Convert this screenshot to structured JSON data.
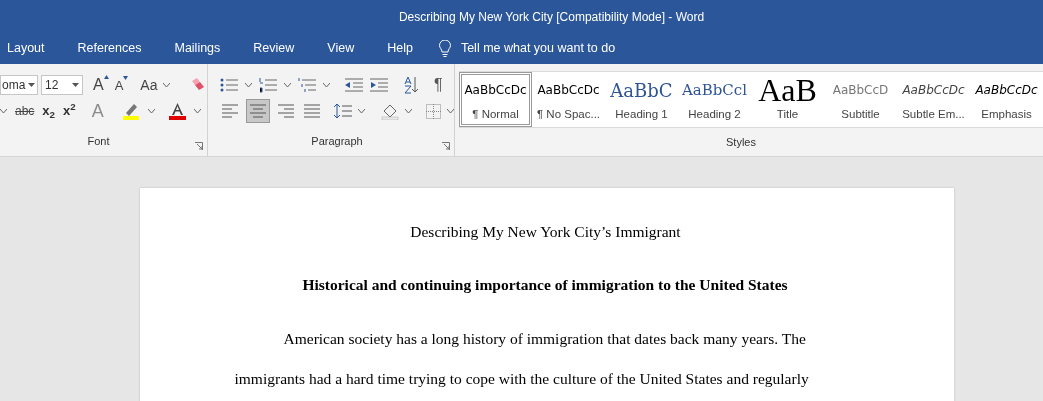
{
  "window": {
    "title": "Describing My New York City [Compatibility Mode]  -  Word"
  },
  "tabs": [
    {
      "label": "Layout",
      "selected": false
    },
    {
      "label": "References",
      "selected": false
    },
    {
      "label": "Mailings",
      "selected": false
    },
    {
      "label": "Review",
      "selected": false
    },
    {
      "label": "View",
      "selected": false
    },
    {
      "label": "Help",
      "selected": false
    }
  ],
  "tell_me": {
    "placeholder": "Tell me what you want to do"
  },
  "font_group": {
    "font_name": "oma",
    "font_size": "12",
    "grow_font": "A",
    "shrink_font": "A",
    "change_case": "Aa",
    "strikethrough": "abc",
    "subscript": "x$_{2}$",
    "superscript": "x$^{2}$",
    "text_effects": "A",
    "label": "Font"
  },
  "paragraph_group": {
    "label": "Paragraph",
    "show_marks": "¶",
    "alignment_buttons": [
      {
        "kind": "left",
        "selected": false
      },
      {
        "kind": "center",
        "selected": true
      },
      {
        "kind": "right",
        "selected": false
      },
      {
        "kind": "justify",
        "selected": false
      }
    ]
  },
  "styles_group": {
    "label": "Styles",
    "styles": [
      {
        "preview": "AaBbCcDc",
        "name": "¶ Normal",
        "kind": "normal",
        "selected": true
      },
      {
        "preview": "AaBbCcDc",
        "name": "¶ No Spac...",
        "kind": "normal",
        "selected": false
      },
      {
        "preview": "AaBbC",
        "name": "Heading 1",
        "kind": "heading1",
        "selected": false
      },
      {
        "preview": "AaBbCcl",
        "name": "Heading 2",
        "kind": "heading2",
        "selected": false
      },
      {
        "preview": "AaB",
        "name": "Title",
        "kind": "title",
        "selected": false
      },
      {
        "preview": "AaBbCcD",
        "name": "Subtitle",
        "kind": "subtitle",
        "selected": false
      },
      {
        "preview": "AaBbCcDc",
        "name": "Subtle Em...",
        "kind": "subtle",
        "selected": false
      },
      {
        "preview": "AaBbCcDc",
        "name": "Emphasis",
        "kind": "emphasis",
        "selected": false
      }
    ]
  },
  "document": {
    "title": "Describing My New York City’s Immigrant",
    "heading": "Historical and continuing importance of immigration to the United States",
    "body_lines": [
      {
        "text": "American society has a long history of immigration that dates back many years. The",
        "kind": "first"
      },
      {
        "text": "immigrants had a hard time trying to cope with the culture of the United States and regularly",
        "kind": "line"
      }
    ]
  }
}
